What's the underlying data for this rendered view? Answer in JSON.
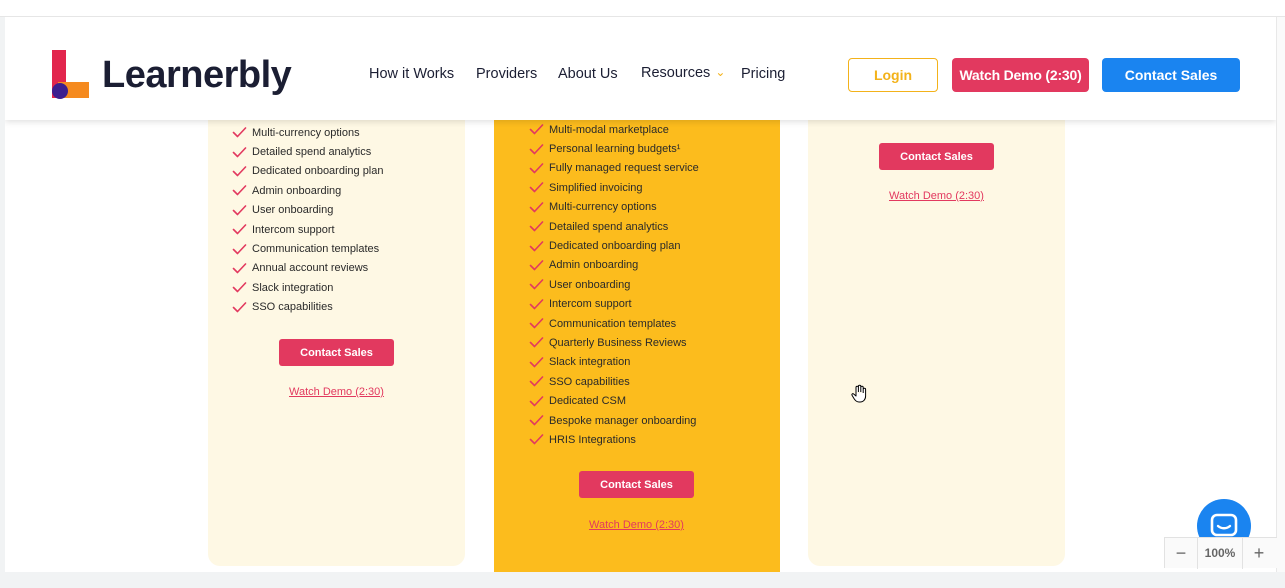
{
  "brand": {
    "name": "Learnerbly",
    "colors": {
      "red": "#e2264d",
      "orange": "#f58a1f",
      "purple": "#3d1f8f",
      "gold": "#fcbc1d",
      "blue": "#1a84f0",
      "cream": "#fef8e4"
    }
  },
  "nav": {
    "how_it_works": "How it Works",
    "providers": "Providers",
    "about_us": "About Us",
    "resources": "Resources",
    "pricing": "Pricing"
  },
  "header_buttons": {
    "login": "Login",
    "watch_demo": "Watch Demo (2:30)",
    "contact_sales": "Contact Sales"
  },
  "plans": {
    "left": {
      "features": [
        "Multi-currency options",
        "Detailed spend analytics",
        "Dedicated onboarding plan",
        "Admin onboarding",
        "User onboarding",
        "Intercom support",
        "Communication templates",
        "Annual account reviews",
        "Slack integration",
        "SSO capabilities"
      ],
      "cta": "Contact Sales",
      "demo_link": "Watch Demo (2:30)"
    },
    "middle": {
      "features": [
        "Multi-modal marketplace",
        "Personal learning budgets¹",
        "Fully managed request service",
        "Simplified invoicing",
        "Multi-currency options",
        "Detailed spend analytics",
        "Dedicated onboarding plan",
        "Admin onboarding",
        "User onboarding",
        "Intercom support",
        "Communication templates",
        "Quarterly Business Reviews",
        "Slack integration",
        "SSO capabilities",
        "Dedicated CSM",
        "Bespoke manager onboarding",
        "HRIS Integrations"
      ],
      "cta": "Contact Sales",
      "demo_link": "Watch Demo (2:30)"
    },
    "right": {
      "cta": "Contact Sales",
      "demo_link": "Watch Demo (2:30)"
    }
  },
  "zoom": {
    "minus": "−",
    "level": "100%",
    "plus": "+"
  },
  "icons": [
    "logo-mark-icon",
    "chevron-down-icon",
    "check-icon",
    "hand-cursor-icon",
    "chat-icon"
  ]
}
